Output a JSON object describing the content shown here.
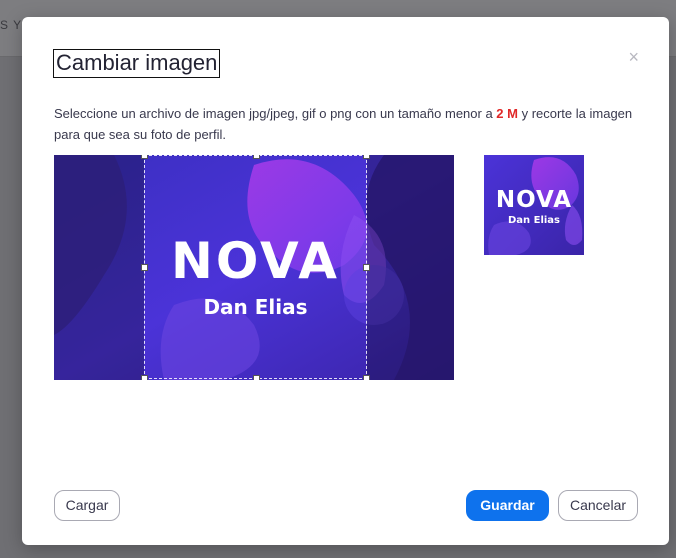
{
  "backdrop": {
    "text": "S Y F"
  },
  "dialog": {
    "title": "Cambiar imagen",
    "close_icon": "×",
    "instructions": {
      "before": "Seleccione un archivo de imagen jpg/jpeg, gif o png con un tamaño menor a ",
      "size_limit": "2 M",
      "after": " y recorte la imagen para que sea su foto de perfil."
    },
    "image": {
      "brand_text": "NOVA",
      "name_text": "Dan Elias"
    },
    "buttons": {
      "upload": "Cargar",
      "save": "Guardar",
      "cancel": "Cancelar"
    }
  },
  "colors": {
    "primary": "#0e72ed",
    "size_limit": "#e02828",
    "image_bg": "#4a2fd0",
    "image_accent": "#7a3df0"
  }
}
